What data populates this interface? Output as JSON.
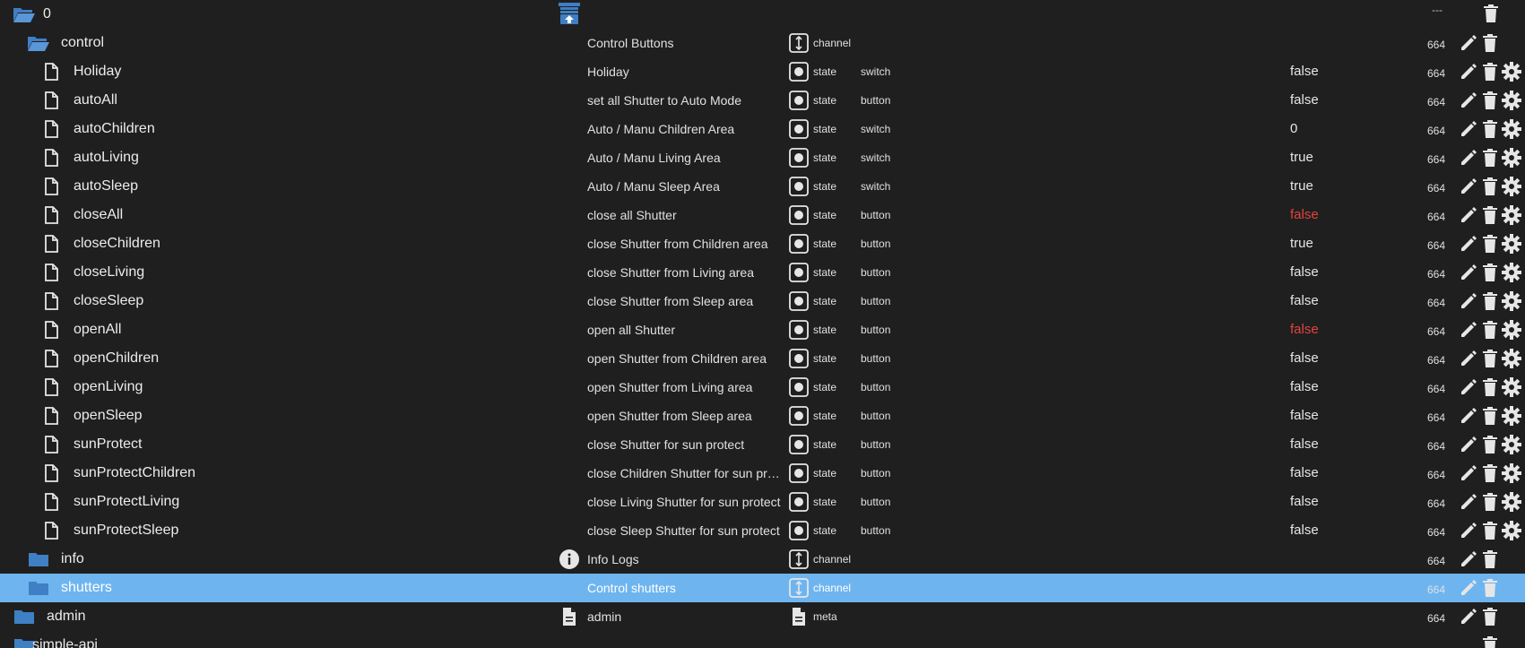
{
  "colors": {
    "background": "#1f1f1f",
    "selected_row": "#6eb5f0",
    "folder": "#3f7fc4",
    "false_red": "#e0443e"
  },
  "top_row": {
    "label": "0",
    "more_label": "---",
    "icon": "upload-image-icon"
  },
  "rows": [
    {
      "label": "control",
      "kind": "folder-open",
      "name": "Control Buttons",
      "type": "channel",
      "role": "",
      "value": "",
      "acl": "664"
    },
    {
      "label": "Holiday",
      "kind": "file",
      "name": "Holiday",
      "type": "state",
      "role": "switch",
      "value": "false",
      "acl": "664"
    },
    {
      "label": "autoAll",
      "kind": "file",
      "name": "set all Shutter to Auto Mode",
      "type": "state",
      "role": "button",
      "value": "false",
      "acl": "664"
    },
    {
      "label": "autoChildren",
      "kind": "file",
      "name": "Auto / Manu Children Area",
      "type": "state",
      "role": "switch",
      "value": "0",
      "acl": "664"
    },
    {
      "label": "autoLiving",
      "kind": "file",
      "name": "Auto / Manu Living Area",
      "type": "state",
      "role": "switch",
      "value": "true",
      "acl": "664"
    },
    {
      "label": "autoSleep",
      "kind": "file",
      "name": "Auto / Manu Sleep Area",
      "type": "state",
      "role": "switch",
      "value": "true",
      "acl": "664"
    },
    {
      "label": "closeAll",
      "kind": "file",
      "name": "close all Shutter",
      "type": "state",
      "role": "button",
      "value": "false",
      "value_red": true,
      "acl": "664"
    },
    {
      "label": "closeChildren",
      "kind": "file",
      "name": "close Shutter from Children area",
      "type": "state",
      "role": "button",
      "value": "true",
      "acl": "664"
    },
    {
      "label": "closeLiving",
      "kind": "file",
      "name": "close Shutter from Living area",
      "type": "state",
      "role": "button",
      "value": "false",
      "acl": "664"
    },
    {
      "label": "closeSleep",
      "kind": "file",
      "name": "close Shutter from Sleep area",
      "type": "state",
      "role": "button",
      "value": "false",
      "acl": "664"
    },
    {
      "label": "openAll",
      "kind": "file",
      "name": "open all Shutter",
      "type": "state",
      "role": "button",
      "value": "false",
      "value_red": true,
      "acl": "664"
    },
    {
      "label": "openChildren",
      "kind": "file",
      "name": "open Shutter from Children area",
      "type": "state",
      "role": "button",
      "value": "false",
      "acl": "664"
    },
    {
      "label": "openLiving",
      "kind": "file",
      "name": "open Shutter from Living area",
      "type": "state",
      "role": "button",
      "value": "false",
      "acl": "664"
    },
    {
      "label": "openSleep",
      "kind": "file",
      "name": "open Shutter from Sleep area",
      "type": "state",
      "role": "button",
      "value": "false",
      "acl": "664"
    },
    {
      "label": "sunProtect",
      "kind": "file",
      "name": "close Shutter for sun protect",
      "type": "state",
      "role": "button",
      "value": "false",
      "acl": "664"
    },
    {
      "label": "sunProtectChildren",
      "kind": "file",
      "name": "close Children Shutter for sun prot...",
      "type": "state",
      "role": "button",
      "value": "false",
      "acl": "664"
    },
    {
      "label": "sunProtectLiving",
      "kind": "file",
      "name": "close Living Shutter for sun protect",
      "type": "state",
      "role": "button",
      "value": "false",
      "acl": "664"
    },
    {
      "label": "sunProtectSleep",
      "kind": "file",
      "name": "close Sleep Shutter for sun protect",
      "type": "state",
      "role": "button",
      "value": "false",
      "acl": "664"
    },
    {
      "label": "info",
      "kind": "folder",
      "name": "Info Logs",
      "name_icon": "info-icon",
      "type": "channel",
      "role": "",
      "value": "",
      "acl": "664"
    },
    {
      "label": "shutters",
      "kind": "folder",
      "name": "Control shutters",
      "type": "channel",
      "role": "",
      "value": "",
      "acl": "664",
      "selected": true
    },
    {
      "label": "admin",
      "kind": "folder",
      "name": "admin",
      "name_icon": "document-icon",
      "type": "meta",
      "role": "",
      "value": "",
      "acl": "664"
    },
    {
      "label": "simple-api",
      "kind": "folder",
      "name": "",
      "type": "",
      "role": "",
      "value": "",
      "acl": ""
    }
  ]
}
